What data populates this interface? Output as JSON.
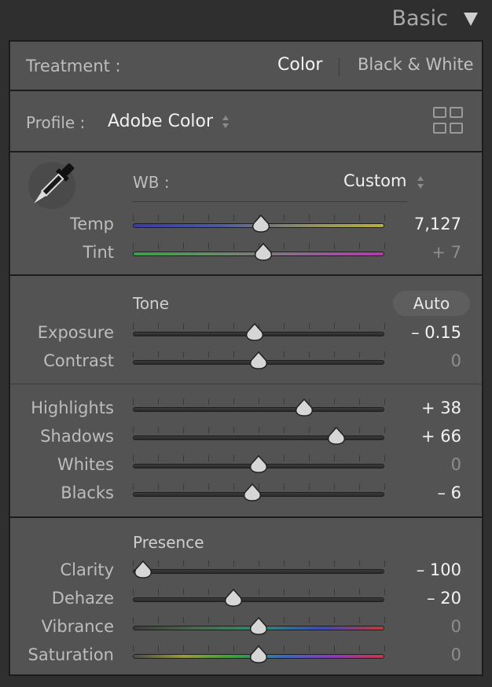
{
  "panel": {
    "title": "Basic"
  },
  "treatment": {
    "label": "Treatment :",
    "color": "Color",
    "bw": "Black & White"
  },
  "profile": {
    "label": "Profile :",
    "value": "Adobe Color"
  },
  "wb": {
    "label": "WB :",
    "value": "Custom"
  },
  "tone": {
    "heading": "Tone",
    "auto": "Auto"
  },
  "presence": {
    "heading": "Presence"
  },
  "sliders": [
    {
      "name": "Temp",
      "value": "7,127",
      "pos": 0.51,
      "track": "temp",
      "bright": true
    },
    {
      "name": "Tint",
      "value": "+ 7",
      "pos": 0.52,
      "track": "tint",
      "bright": false
    },
    {
      "name": "Exposure",
      "value": "– 0.15",
      "pos": 0.485,
      "track": "gray",
      "bright": true
    },
    {
      "name": "Contrast",
      "value": "0",
      "pos": 0.5,
      "track": "gray",
      "bright": false
    },
    {
      "name": "Highlights",
      "value": "+ 38",
      "pos": 0.68,
      "track": "gray",
      "bright": true
    },
    {
      "name": "Shadows",
      "value": "+ 66",
      "pos": 0.81,
      "track": "gray",
      "bright": true
    },
    {
      "name": "Whites",
      "value": "0",
      "pos": 0.5,
      "track": "gray",
      "bright": false
    },
    {
      "name": "Blacks",
      "value": "– 6",
      "pos": 0.475,
      "track": "gray",
      "bright": true
    },
    {
      "name": "Clarity",
      "value": "– 100",
      "pos": 0.04,
      "track": "gray",
      "bright": true
    },
    {
      "name": "Dehaze",
      "value": "– 20",
      "pos": 0.4,
      "track": "gray",
      "bright": true
    },
    {
      "name": "Vibrance",
      "value": "0",
      "pos": 0.5,
      "track": "vib",
      "bright": false
    },
    {
      "name": "Saturation",
      "value": "0",
      "pos": 0.5,
      "track": "sat",
      "bright": false
    }
  ],
  "colors": {
    "temp_track": [
      "#3a3aa8",
      "#4a5aa0",
      "#8a8a6a",
      "#b8b03a"
    ],
    "tint_track": [
      "#3aa04a",
      "#6a8a6a",
      "#8a6a8a",
      "#b03aa8"
    ],
    "vib_track": [
      "#3c3c3c",
      "#4a6a4a",
      "#2e8a6a",
      "#3a4ab8",
      "#c03a3a"
    ],
    "sat_track": [
      "#4c4c4c",
      "#9a9a3a",
      "#3aa03a",
      "#3a6ab8",
      "#8a3ab8",
      "#c03a4a"
    ]
  }
}
